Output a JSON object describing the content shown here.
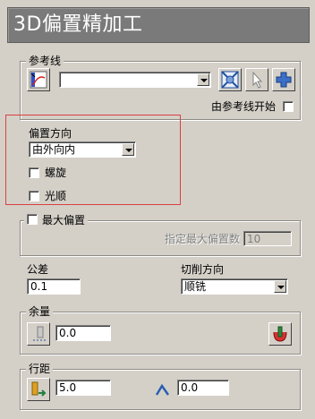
{
  "title": "3D偏置精加工",
  "reference": {
    "group_label": "参考线",
    "curve_select_value": "",
    "start_from_reference_label": "由参考线开始"
  },
  "offset": {
    "direction_label": "偏置方向",
    "direction_value": "由外向内",
    "spiral_label": "螺旋",
    "smooth_label": "光顺"
  },
  "max_offset": {
    "label": "最大偏置",
    "specify_label": "指定最大偏置数",
    "specify_value": "10"
  },
  "tolerance": {
    "label": "公差",
    "value": "0.1"
  },
  "cut_direction": {
    "label": "切削方向",
    "value": "顺铣"
  },
  "allowance": {
    "label": "余量",
    "value": "0.0"
  },
  "stepover": {
    "label": "行距",
    "value": "5.0",
    "stepdown_value": "0.0"
  },
  "colors": {
    "title_bg": "#7a7a7a",
    "highlight_border": "#d94040",
    "panel_bg": "#d4d0c8"
  },
  "icons": [
    "curve-select-icon",
    "curve-edit-icon",
    "pointer-icon",
    "add-icon",
    "thickness-icon",
    "allowance-tool-icon",
    "stepover-tool-icon",
    "stepdown-icon"
  ]
}
